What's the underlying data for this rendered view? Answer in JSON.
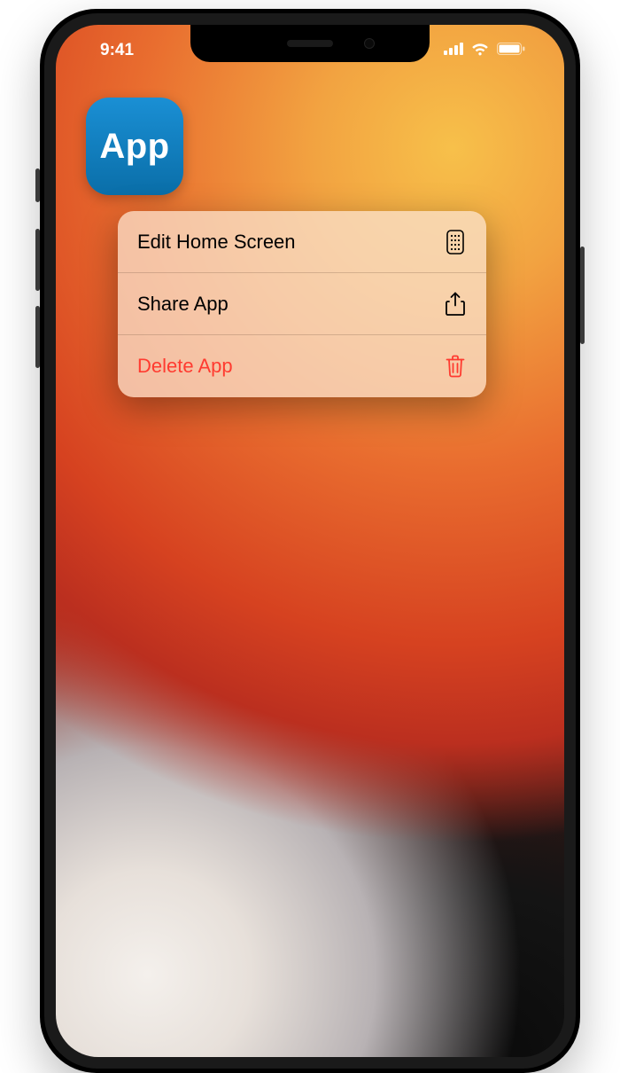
{
  "status_bar": {
    "time": "9:41"
  },
  "app": {
    "icon_text": "App"
  },
  "context_menu": {
    "items": [
      {
        "label": "Edit Home Screen",
        "icon": "home-screen-grid-icon",
        "destructive": false
      },
      {
        "label": "Share App",
        "icon": "share-icon",
        "destructive": false
      },
      {
        "label": "Delete App",
        "icon": "trash-icon",
        "destructive": true
      }
    ]
  },
  "colors": {
    "destructive": "#ff3b30",
    "app_icon_bg_top": "#1a8fd4",
    "app_icon_bg_bottom": "#0a6ea8"
  }
}
